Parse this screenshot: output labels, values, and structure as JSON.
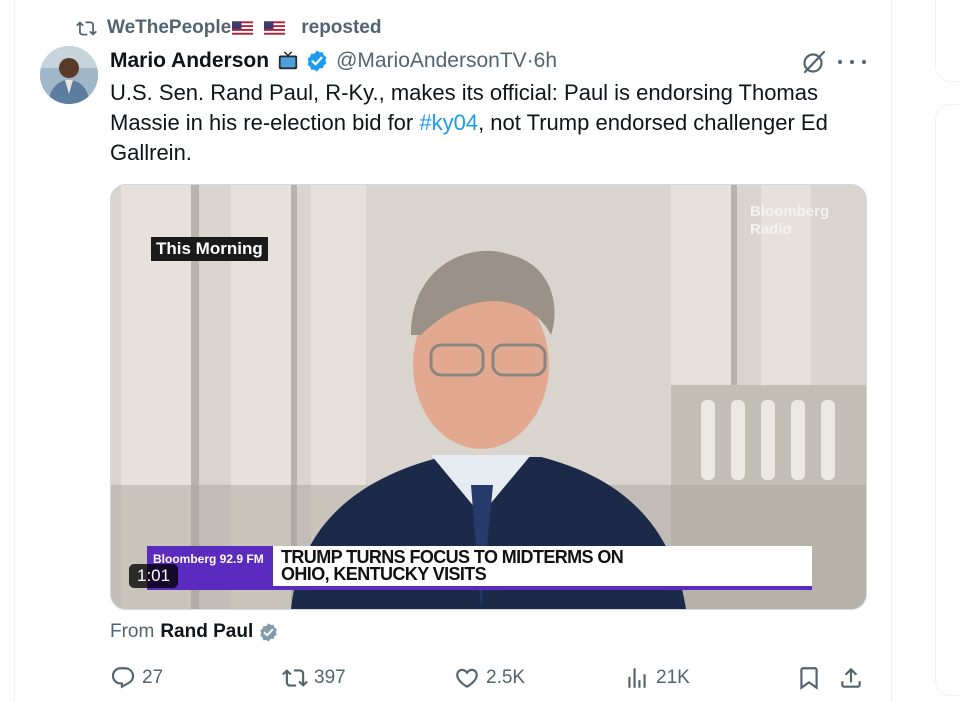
{
  "repost": {
    "user": "WeThePeople",
    "label": "reposted"
  },
  "tweet": {
    "author_name": "Mario Anderson",
    "handle": "@MarioAndersonTV",
    "time_sep": " · ",
    "time": "6h",
    "text_before": "U.S. Sen. Rand Paul, R-Ky., makes its official:  Paul is endorsing Thomas Massie in his re-election bid for ",
    "hashtag": "#ky04",
    "text_after": ", not Trump endorsed challenger Ed Gallrein."
  },
  "media": {
    "logo_line1": "Bloomberg",
    "logo_line2": "Radio",
    "show_label": "This Morning",
    "ticker_station": "Bloomberg 92.9 FM",
    "headline_line1": "TRUMP TURNS FOCUS TO MIDTERMS ON",
    "headline_line2": "OHIO, KENTUCKY VISITS",
    "duration": "1:01"
  },
  "from": {
    "prefix": "From",
    "name": "Rand Paul"
  },
  "actions": {
    "replies": "27",
    "reposts": "397",
    "likes": "2.5K",
    "views": "21K"
  },
  "colors": {
    "accent": "#1d9bf0",
    "muted": "#536471",
    "bloomberg_purple": "#5b2bbf"
  }
}
